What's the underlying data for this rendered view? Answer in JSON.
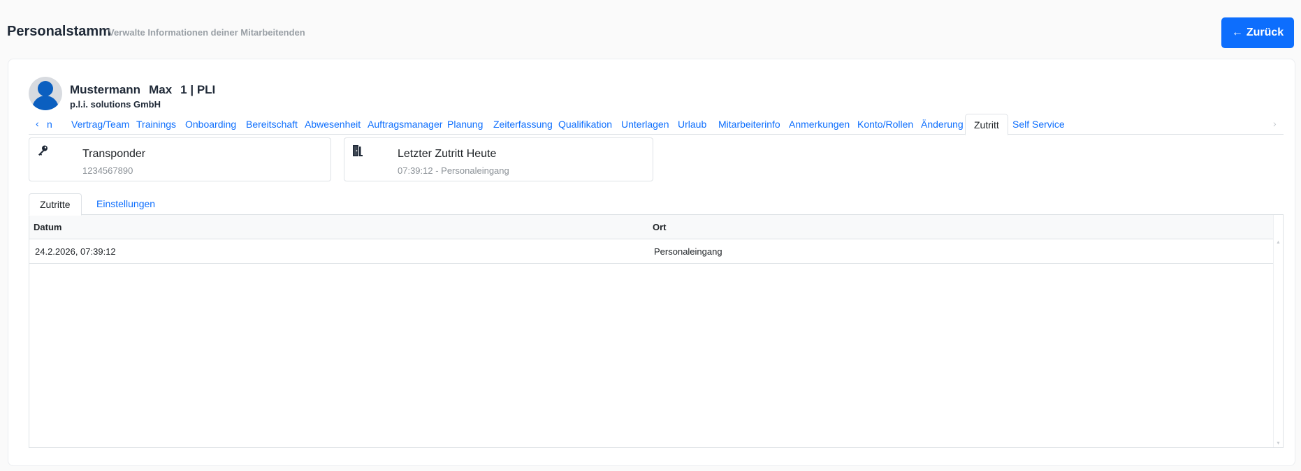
{
  "header": {
    "title": "Personalstamm",
    "subtitle": "Verwalte Informationen deiner Mitarbeitenden",
    "back_label": "Zurück"
  },
  "profile": {
    "last_name": "Mustermann",
    "first_name": "Max",
    "id_label": "1 | PLI",
    "company": "p.l.i. solutions GmbH"
  },
  "tabs": {
    "items": [
      {
        "label": "n"
      },
      {
        "label": "Vertrag/Team"
      },
      {
        "label": "Trainings"
      },
      {
        "label": "Onboarding"
      },
      {
        "label": "Bereitschaft"
      },
      {
        "label": "Abwesenheit"
      },
      {
        "label": "Auftragsmanager"
      },
      {
        "label": "Planung"
      },
      {
        "label": "Zeiterfassung"
      },
      {
        "label": "Qualifikation"
      },
      {
        "label": "Unterlagen"
      },
      {
        "label": "Urlaub"
      },
      {
        "label": "Mitarbeiterinfo"
      },
      {
        "label": "Anmerkungen"
      },
      {
        "label": "Konto/Rollen"
      },
      {
        "label": "Änderung"
      },
      {
        "label": "Zutritt"
      },
      {
        "label": "Self Service"
      }
    ],
    "active": "Zutritt"
  },
  "transponder": {
    "title": "Transponder",
    "value": "1234567890",
    "icon": "key-icon"
  },
  "last_access": {
    "title": "Letzter Zutritt Heute",
    "value": "07:39:12 - Personaleingang",
    "icon": "door-icon"
  },
  "subtabs": {
    "items": [
      {
        "label": "Zutritte"
      },
      {
        "label": "Einstellungen"
      }
    ],
    "active": "Zutritte"
  },
  "table": {
    "columns": [
      "Datum",
      "Ort"
    ],
    "rows": [
      {
        "datum": "24.2.2026, 07:39:12",
        "ort": "Personaleingang"
      }
    ]
  },
  "colors": {
    "primary": "#0d6efd",
    "avatar": "#0b5fc0"
  }
}
